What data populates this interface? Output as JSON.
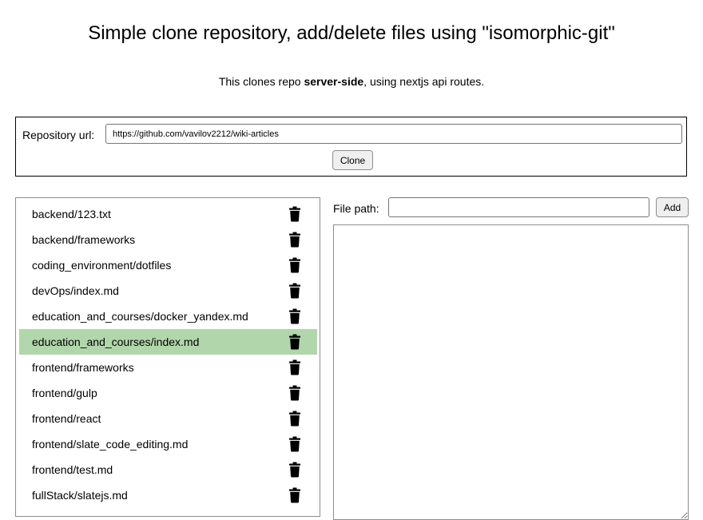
{
  "header": {
    "title": "Simple clone repository, add/delete files using \"isomorphic-git\"",
    "subtitle_prefix": "This clones repo ",
    "subtitle_bold": "server-side",
    "subtitle_suffix": ", using nextjs api routes."
  },
  "repo": {
    "label": "Repository url:",
    "url_value": "https://github.com/vavilov2212/wiki-articles",
    "clone_label": "Clone"
  },
  "files": {
    "items": [
      {
        "name": "backend/123.txt",
        "selected": false,
        "icon": "trash-icon"
      },
      {
        "name": "backend/frameworks",
        "selected": false,
        "icon": "trash-icon"
      },
      {
        "name": "coding_environment/dotfiles",
        "selected": false,
        "icon": "trash-icon"
      },
      {
        "name": "devOps/index.md",
        "selected": false,
        "icon": "trash-icon"
      },
      {
        "name": "education_and_courses/docker_yandex.md",
        "selected": false,
        "icon": "trash-icon"
      },
      {
        "name": "education_and_courses/index.md",
        "selected": true,
        "icon": "trash-icon"
      },
      {
        "name": "frontend/frameworks",
        "selected": false,
        "icon": "trash-icon"
      },
      {
        "name": "frontend/gulp",
        "selected": false,
        "icon": "trash-icon"
      },
      {
        "name": "frontend/react",
        "selected": false,
        "icon": "trash-icon"
      },
      {
        "name": "frontend/slate_code_editing.md",
        "selected": false,
        "icon": "trash-icon"
      },
      {
        "name": "frontend/test.md",
        "selected": false,
        "icon": "trash-icon"
      },
      {
        "name": "fullStack/slatejs.md",
        "selected": false,
        "icon": "trash-icon"
      }
    ],
    "selected_color": "#b1d6ab"
  },
  "editor": {
    "file_path_label": "File path:",
    "file_path_value": "",
    "add_label": "Add",
    "content": ""
  }
}
